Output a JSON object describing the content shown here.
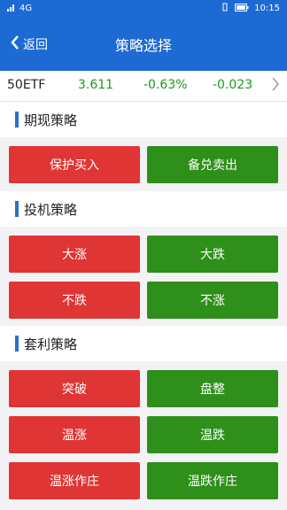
{
  "status": {
    "network": "4G",
    "time": "10:15"
  },
  "nav": {
    "back_label": "返回",
    "title": "策略选择"
  },
  "quote": {
    "symbol": "50ETF",
    "price": "3.611",
    "pct": "-0.63%",
    "change": "-0.023"
  },
  "colors": {
    "primary": "#1d6ad4",
    "up": "#e03535",
    "down": "#2e8f1a",
    "accent_bar": "#2f6ec7"
  },
  "sections": [
    {
      "title": "期现策略",
      "buttons": [
        "保护买入",
        "备兑卖出"
      ]
    },
    {
      "title": "投机策略",
      "buttons": [
        "大涨",
        "大跌",
        "不跌",
        "不涨"
      ]
    },
    {
      "title": "套利策略",
      "buttons": [
        "突破",
        "盘整",
        "温涨",
        "温跌",
        "温涨作庄",
        "温跌作庄"
      ]
    }
  ]
}
